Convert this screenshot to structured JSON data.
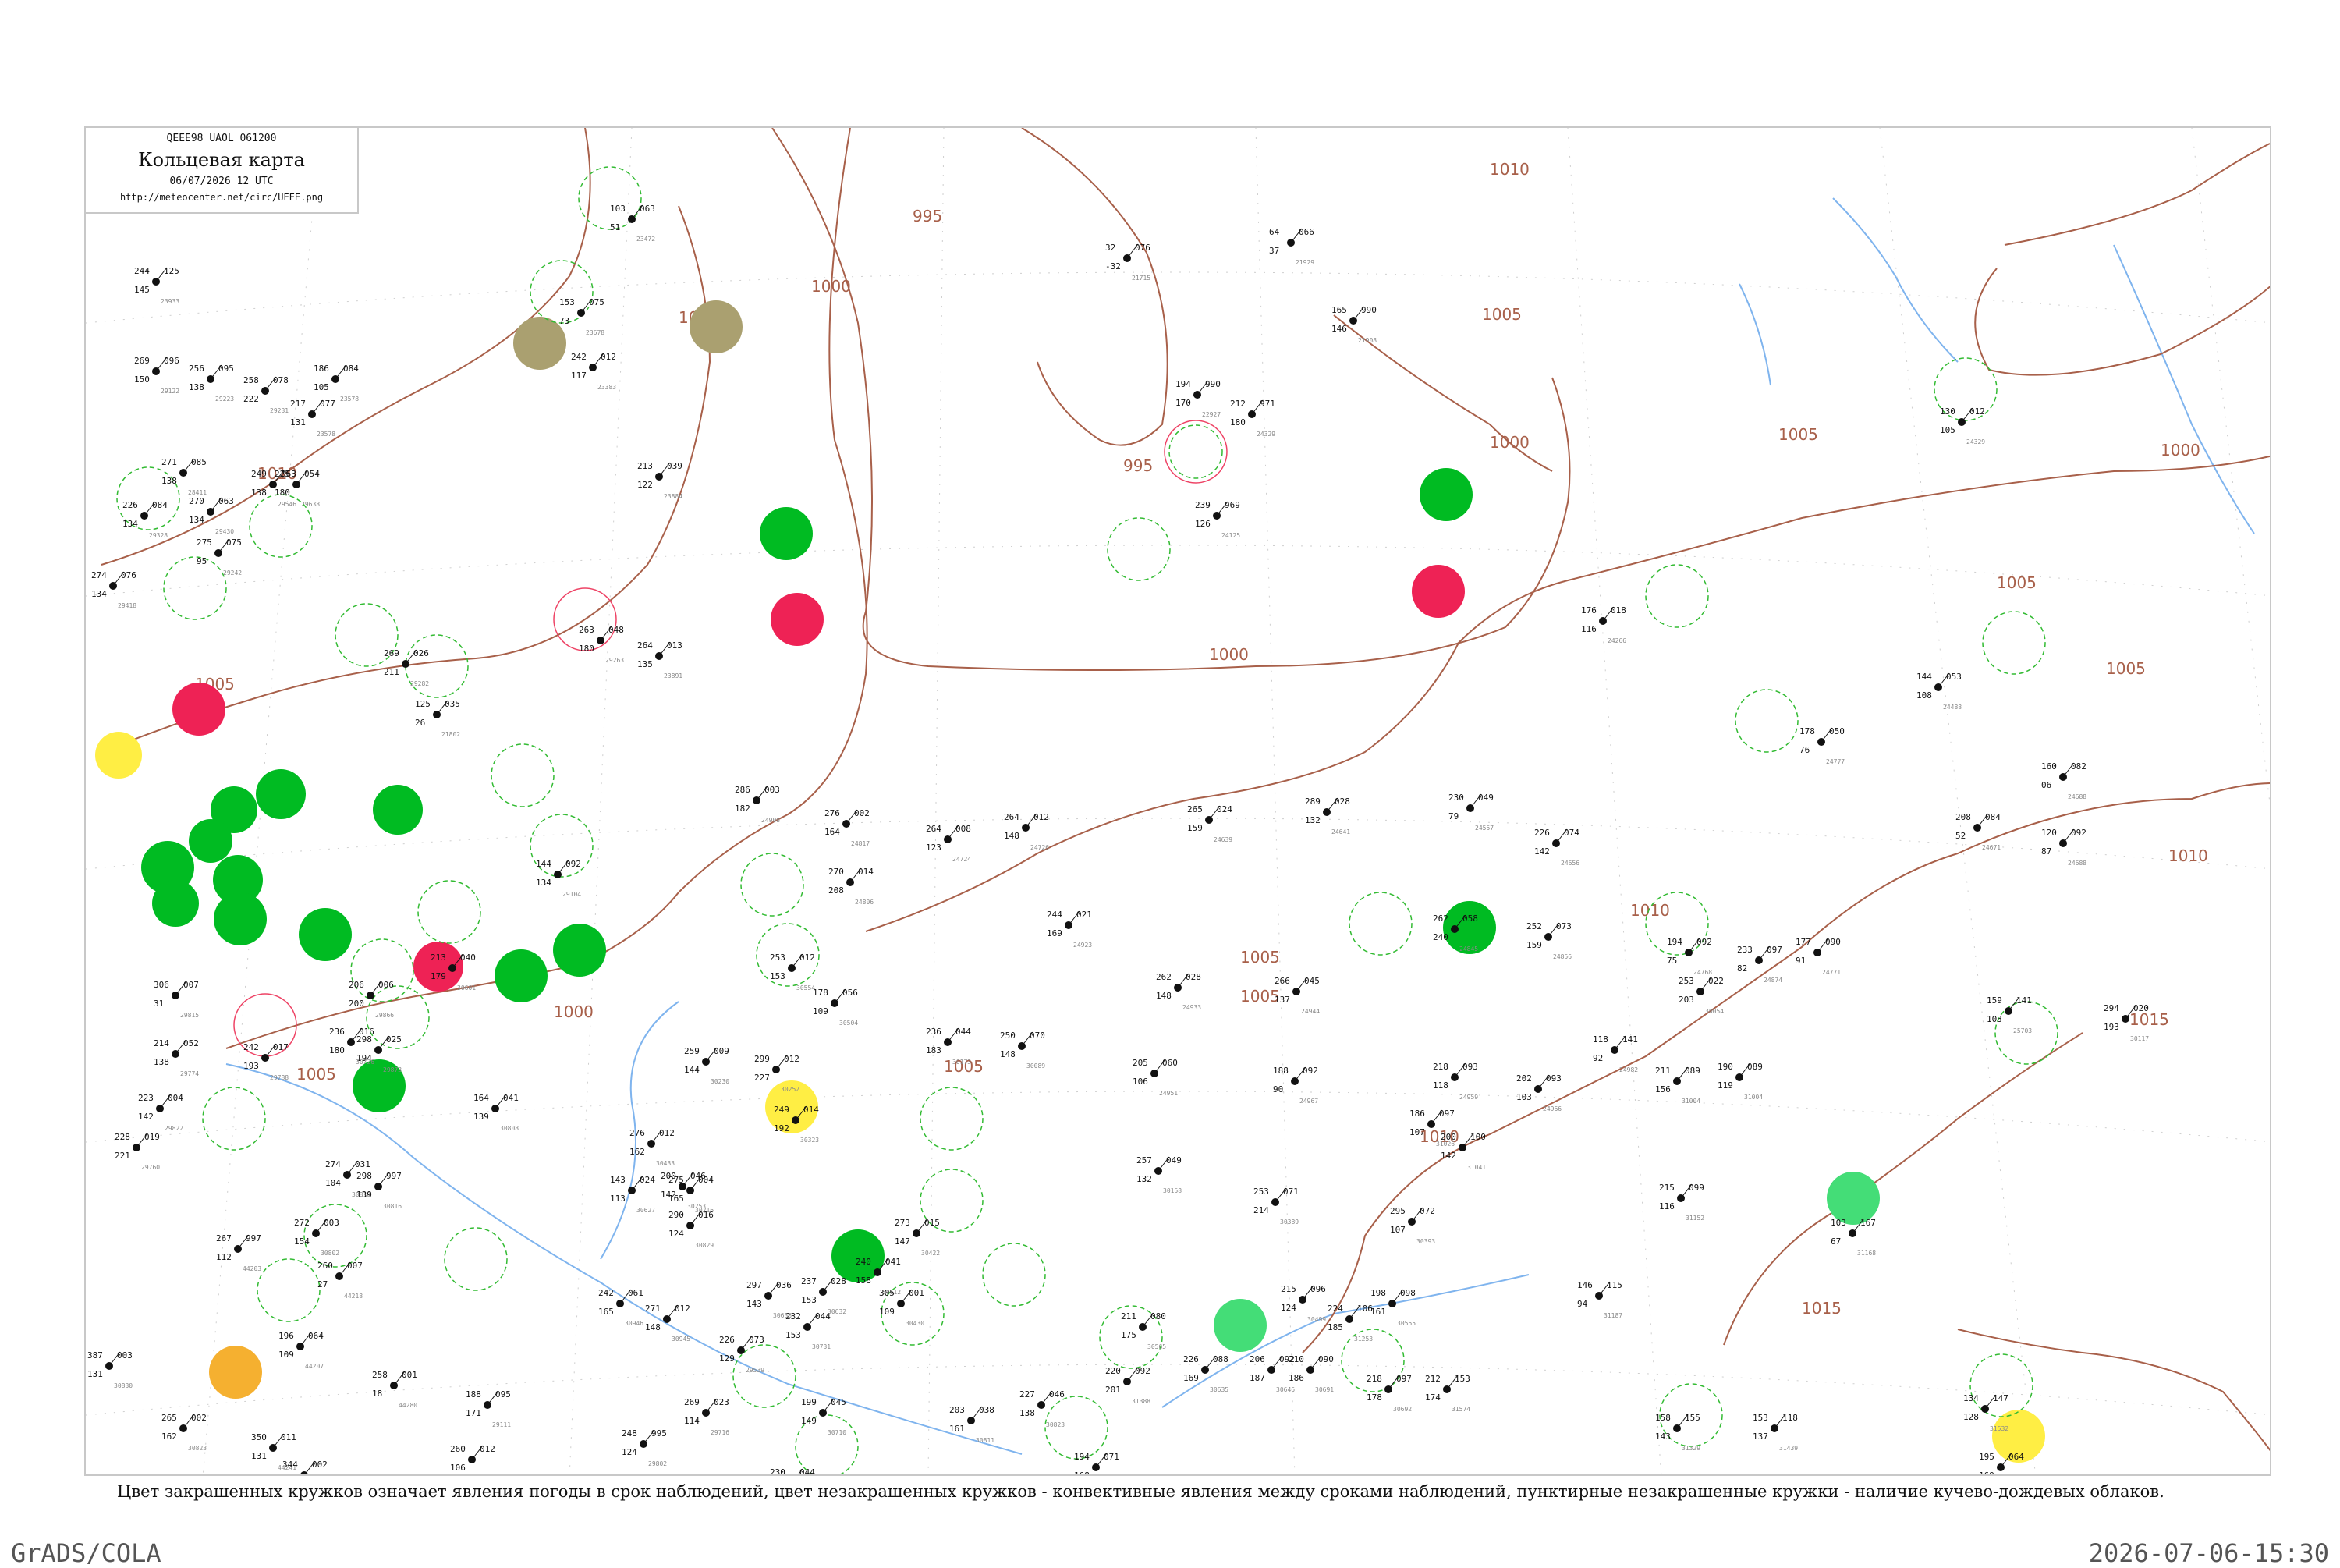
{
  "header": {
    "code_line": "QEEE98  UAOL  061200",
    "title": "Кольцевая карта",
    "date": "06/07/2026 12 UTC",
    "url": "http://meteocenter.net/circ/UEEE.png"
  },
  "legend_caption": "Цвет закрашенных кружков означает явления погоды в срок наблюдений, цвет незакрашенных кружков - конвективные явления между сроками наблюдений, пунктирные незакрашенные кружки - наличие кучево-дождевых облаков.",
  "footer": {
    "left": "GrADS/COLA",
    "right": "2026-07-06-15:30"
  },
  "colors": {
    "isobar": "#a8604a",
    "river": "#7fb4ee",
    "marker_green": "#00bb22",
    "marker_red": "#ee2255",
    "marker_yellow": "#ffee44",
    "marker_olive": "#aaa070",
    "marker_orange": "#f5b030",
    "ring_green_dashed": "#33bb33",
    "ring_red": "#ee4466"
  },
  "isobar_labels": [
    "995",
    "1000",
    "1005",
    "1010",
    "1015"
  ],
  "stations": [
    {
      "temp": "244",
      "pres": "125",
      "dew": "145",
      "id": "23933"
    },
    {
      "temp": "269",
      "pres": "096",
      "dew": "150",
      "id": "29122"
    },
    {
      "temp": "256",
      "pres": "095",
      "dew": "138",
      "id": "29223"
    },
    {
      "temp": "258",
      "pres": "078",
      "dew": "222",
      "id": "29231"
    },
    {
      "temp": "271",
      "pres": "085",
      "dew": "138",
      "id": "28411"
    },
    {
      "temp": "226",
      "pres": "084",
      "dew": "134",
      "id": "29328"
    },
    {
      "temp": "274",
      "pres": "076",
      "dew": "134",
      "id": "29418"
    },
    {
      "temp": "270",
      "pres": "063",
      "dew": "134",
      "id": "29430"
    },
    {
      "temp": "275",
      "pres": "075",
      "dew": "95",
      "id": "29242"
    },
    {
      "temp": "249",
      "pres": "063",
      "dew": "138",
      "id": "29546"
    },
    {
      "temp": "225",
      "pres": "054",
      "dew": "180",
      "id": "29638"
    },
    {
      "temp": "217",
      "pres": "077",
      "dew": "131",
      "id": "23578"
    },
    {
      "temp": "186",
      "pres": "084",
      "dew": "105",
      "id": "23578"
    },
    {
      "temp": "103",
      "pres": "063",
      "dew": "51",
      "id": "23472"
    },
    {
      "temp": "153",
      "pres": "075",
      "dew": "73",
      "id": "23678"
    },
    {
      "temp": "242",
      "pres": "012",
      "dew": "117",
      "id": "23383"
    },
    {
      "temp": "213",
      "pres": "039",
      "dew": "122",
      "id": "23884"
    },
    {
      "temp": "264",
      "pres": "013",
      "dew": "135",
      "id": "23891"
    },
    {
      "temp": "263",
      "pres": "048",
      "dew": "180",
      "id": "29263"
    },
    {
      "temp": "269",
      "pres": "026",
      "dew": "211",
      "id": "29282"
    },
    {
      "temp": "125",
      "pres": "035",
      "dew": "26",
      "id": "21802"
    },
    {
      "temp": "32",
      "pres": "076",
      "dew": "-32",
      "id": "21715"
    },
    {
      "temp": "64",
      "pres": "066",
      "dew": "37",
      "id": "21929"
    },
    {
      "temp": "165",
      "pres": "990",
      "dew": "146",
      "id": "21908"
    },
    {
      "temp": "194",
      "pres": "990",
      "dew": "170",
      "id": "22927"
    },
    {
      "temp": "212",
      "pres": "971",
      "dew": "180",
      "id": "24329"
    },
    {
      "temp": "239",
      "pres": "969",
      "dew": "126",
      "id": "24125"
    },
    {
      "temp": "176",
      "pres": "018",
      "dew": "116",
      "id": "24266"
    },
    {
      "temp": "130",
      "pres": "012",
      "dew": "105",
      "id": "24329"
    },
    {
      "temp": "144",
      "pres": "053",
      "dew": "108",
      "id": "24488"
    },
    {
      "temp": "178",
      "pres": "050",
      "dew": "76",
      "id": "24777"
    },
    {
      "temp": "160",
      "pres": "082",
      "dew": "06",
      "id": "24688"
    },
    {
      "temp": "208",
      "pres": "084",
      "dew": "52",
      "id": "24671"
    },
    {
      "temp": "120",
      "pres": "092",
      "dew": "87",
      "id": "24688"
    },
    {
      "temp": "286",
      "pres": "003",
      "dew": "182",
      "id": "24908"
    },
    {
      "temp": "276",
      "pres": "002",
      "dew": "164",
      "id": "24817"
    },
    {
      "temp": "264",
      "pres": "008",
      "dew": "123",
      "id": "24724"
    },
    {
      "temp": "264",
      "pres": "012",
      "dew": "148",
      "id": "24726"
    },
    {
      "temp": "265",
      "pres": "024",
      "dew": "159",
      "id": "24639"
    },
    {
      "temp": "289",
      "pres": "028",
      "dew": "132",
      "id": "24641"
    },
    {
      "temp": "230",
      "pres": "049",
      "dew": "79",
      "id": "24557"
    },
    {
      "temp": "226",
      "pres": "074",
      "dew": "142",
      "id": "24656"
    },
    {
      "temp": "270",
      "pres": "014",
      "dew": "208",
      "id": "24806"
    },
    {
      "temp": "244",
      "pres": "021",
      "dew": "169",
      "id": "24923"
    },
    {
      "temp": "262",
      "pres": "028",
      "dew": "148",
      "id": "24933"
    },
    {
      "temp": "266",
      "pres": "045",
      "dew": "137",
      "id": "24944"
    },
    {
      "temp": "262",
      "pres": "058",
      "dew": "240",
      "id": "24845"
    },
    {
      "temp": "252",
      "pres": "073",
      "dew": "159",
      "id": "24856"
    },
    {
      "temp": "194",
      "pres": "092",
      "dew": "75",
      "id": "24768"
    },
    {
      "temp": "233",
      "pres": "097",
      "dew": "82",
      "id": "24874"
    },
    {
      "temp": "177",
      "pres": "090",
      "dew": "91",
      "id": "24771"
    },
    {
      "temp": "253",
      "pres": "022",
      "dew": "203",
      "id": "30054"
    },
    {
      "temp": "294",
      "pres": "020",
      "dew": "193",
      "id": "30117"
    },
    {
      "temp": "236",
      "pres": "044",
      "dew": "183",
      "id": "30173"
    },
    {
      "temp": "250",
      "pres": "070",
      "dew": "148",
      "id": "30089"
    },
    {
      "temp": "205",
      "pres": "060",
      "dew": "106",
      "id": "24951"
    },
    {
      "temp": "188",
      "pres": "092",
      "dew": "90",
      "id": "24967"
    },
    {
      "temp": "218",
      "pres": "093",
      "dew": "118",
      "id": "24959"
    },
    {
      "temp": "202",
      "pres": "093",
      "dew": "103",
      "id": "24966"
    },
    {
      "temp": "118",
      "pres": "141",
      "dew": "92",
      "id": "24982"
    },
    {
      "temp": "211",
      "pres": "089",
      "dew": "156",
      "id": "31004"
    },
    {
      "temp": "190",
      "pres": "089",
      "dew": "119",
      "id": "31004"
    },
    {
      "temp": "186",
      "pres": "097",
      "dew": "107",
      "id": "31026"
    },
    {
      "temp": "200",
      "pres": "100",
      "dew": "142",
      "id": "31041"
    },
    {
      "temp": "159",
      "pres": "141",
      "dew": "103",
      "id": "25703"
    },
    {
      "temp": "257",
      "pres": "049",
      "dew": "132",
      "id": "30158"
    },
    {
      "temp": "253",
      "pres": "071",
      "dew": "214",
      "id": "30389"
    },
    {
      "temp": "295",
      "pres": "072",
      "dew": "107",
      "id": "30393"
    },
    {
      "temp": "215",
      "pres": "099",
      "dew": "116",
      "id": "31152"
    },
    {
      "temp": "103",
      "pres": "167",
      "dew": "67",
      "id": "31168"
    },
    {
      "temp": "146",
      "pres": "115",
      "dew": "94",
      "id": "31187"
    },
    {
      "temp": "215",
      "pres": "096",
      "dew": "124",
      "id": "30499"
    },
    {
      "temp": "224",
      "pres": "106",
      "dew": "185",
      "id": "31253"
    },
    {
      "temp": "226",
      "pres": "088",
      "dew": "169",
      "id": "30635"
    },
    {
      "temp": "206",
      "pres": "092",
      "dew": "187",
      "id": "30646"
    },
    {
      "temp": "210",
      "pres": "090",
      "dew": "186",
      "id": "30691"
    },
    {
      "temp": "218",
      "pres": "097",
      "dew": "178",
      "id": "30692"
    },
    {
      "temp": "212",
      "pres": "153",
      "dew": "174",
      "id": "31574"
    },
    {
      "temp": "198",
      "pres": "098",
      "dew": "161",
      "id": "30555"
    },
    {
      "temp": "211",
      "pres": "080",
      "dew": "175",
      "id": "30565"
    },
    {
      "temp": "220",
      "pres": "092",
      "dew": "201",
      "id": "31388"
    },
    {
      "temp": "186",
      "pres": "108",
      "dew": "151",
      "id": "31300"
    },
    {
      "temp": "158",
      "pres": "155",
      "dew": "143",
      "id": "31329"
    },
    {
      "temp": "153",
      "pres": "118",
      "dew": "137",
      "id": "31439"
    },
    {
      "temp": "147",
      "pres": "152",
      "dew": "149",
      "id": "31538"
    },
    {
      "temp": "134",
      "pres": "147",
      "dew": "128",
      "id": "31532"
    },
    {
      "temp": "195",
      "pres": "064",
      "dew": "169",
      "id": "30965"
    },
    {
      "temp": "194",
      "pres": "071",
      "dew": "168",
      "id": "30953"
    },
    {
      "temp": "227",
      "pres": "046",
      "dew": "138",
      "id": "30823"
    },
    {
      "temp": "203",
      "pres": "038",
      "dew": "161",
      "id": "30811"
    },
    {
      "temp": "199",
      "pres": "045",
      "dew": "149",
      "id": "30710"
    },
    {
      "temp": "230",
      "pres": "044",
      "dew": "129",
      "id": "30714"
    },
    {
      "temp": "232",
      "pres": "044",
      "dew": "153",
      "id": "30731"
    },
    {
      "temp": "237",
      "pres": "028",
      "dew": "153",
      "id": "30632"
    },
    {
      "temp": "240",
      "pres": "041",
      "dew": "158",
      "id": "30612"
    },
    {
      "temp": "305",
      "pres": "001",
      "dew": "109",
      "id": "30430"
    },
    {
      "temp": "273",
      "pres": "015",
      "dew": "147",
      "id": "30422"
    },
    {
      "temp": "276",
      "pres": "012",
      "dew": "162",
      "id": "30433"
    },
    {
      "temp": "200",
      "pres": "046",
      "dew": "142",
      "id": "30253"
    },
    {
      "temp": "275",
      "pres": "004",
      "dew": "165",
      "id": "30216"
    },
    {
      "temp": "249",
      "pres": "014",
      "dew": "192",
      "id": "30323"
    },
    {
      "temp": "259",
      "pres": "009",
      "dew": "144",
      "id": "30230"
    },
    {
      "temp": "299",
      "pres": "012",
      "dew": "227",
      "id": "30252"
    },
    {
      "temp": "253",
      "pres": "012",
      "dew": "153",
      "id": "30554"
    },
    {
      "temp": "178",
      "pres": "056",
      "dew": "109",
      "id": "30504"
    },
    {
      "temp": "143",
      "pres": "024",
      "dew": "113",
      "id": "30627"
    },
    {
      "temp": "290",
      "pres": "016",
      "dew": "124",
      "id": "30829"
    },
    {
      "temp": "297",
      "pres": "036",
      "dew": "143",
      "id": "30636"
    },
    {
      "temp": "242",
      "pres": "061",
      "dew": "165",
      "id": "30946"
    },
    {
      "temp": "271",
      "pres": "012",
      "dew": "148",
      "id": "30945"
    },
    {
      "temp": "226",
      "pres": "073",
      "dew": "129",
      "id": "29539"
    },
    {
      "temp": "269",
      "pres": "023",
      "dew": "114",
      "id": "29716"
    },
    {
      "temp": "248",
      "pres": "995",
      "dew": "124",
      "id": "29802"
    },
    {
      "temp": "306",
      "pres": "007",
      "dew": "31",
      "id": "29815"
    },
    {
      "temp": "214",
      "pres": "052",
      "dew": "138",
      "id": "29774"
    },
    {
      "temp": "223",
      "pres": "004",
      "dew": "142",
      "id": "29822"
    },
    {
      "temp": "228",
      "pres": "019",
      "dew": "221",
      "id": "29760"
    },
    {
      "temp": "242",
      "pres": "017",
      "dew": "193",
      "id": "29788"
    },
    {
      "temp": "206",
      "pres": "006",
      "dew": "200",
      "id": "29866"
    },
    {
      "temp": "298",
      "pres": "025",
      "dew": "194",
      "id": "29873"
    },
    {
      "temp": "213",
      "pres": "040",
      "dew": "179",
      "id": "30601"
    },
    {
      "temp": "236",
      "pres": "016",
      "dew": "180",
      "id": "30726"
    },
    {
      "temp": "164",
      "pres": "041",
      "dew": "139",
      "id": "30808"
    },
    {
      "temp": "274",
      "pres": "031",
      "dew": "104",
      "id": "30810"
    },
    {
      "temp": "298",
      "pres": "997",
      "dew": "139",
      "id": "30816"
    },
    {
      "temp": "272",
      "pres": "003",
      "dew": "154",
      "id": "30802"
    },
    {
      "temp": "267",
      "pres": "997",
      "dew": "112",
      "id": "44203"
    },
    {
      "temp": "260",
      "pres": "007",
      "dew": "27",
      "id": "44218"
    },
    {
      "temp": "196",
      "pres": "064",
      "dew": "109",
      "id": "44207"
    },
    {
      "temp": "258",
      "pres": "001",
      "dew": "18",
      "id": "44280"
    },
    {
      "temp": "350",
      "pres": "011",
      "dew": "131",
      "id": "44241"
    },
    {
      "temp": "387",
      "pres": "003",
      "dew": "131",
      "id": "30830"
    },
    {
      "temp": "265",
      "pres": "002",
      "dew": "162",
      "id": "30823"
    },
    {
      "temp": "344",
      "pres": "002",
      "dew": "219",
      "id": "29570"
    },
    {
      "temp": "260",
      "pres": "012",
      "dew": "106",
      "id": "29462"
    },
    {
      "temp": "188",
      "pres": "095",
      "dew": "171",
      "id": "29111"
    },
    {
      "temp": "144",
      "pres": "092",
      "dew": "134",
      "id": "29104"
    }
  ]
}
